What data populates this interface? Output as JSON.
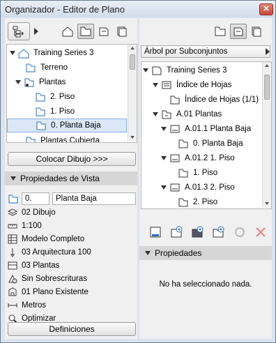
{
  "window": {
    "title": "Organizador - Editor de Plano",
    "close_glyph": "✕"
  },
  "left": {
    "tree": [
      {
        "label": "Training Series 3",
        "icon": "project-icon"
      },
      {
        "label": "Terreno",
        "icon": "story-icon"
      },
      {
        "label": "Plantas",
        "icon": "folder-icon"
      },
      {
        "label": "2. Piso",
        "icon": "story-icon"
      },
      {
        "label": "1. Piso",
        "icon": "story-icon"
      },
      {
        "label": "0. Planta Baja",
        "icon": "story-icon"
      },
      {
        "label": "Plantas Cubierta",
        "icon": "story-icon"
      }
    ],
    "place_button": "Colocar Dibujo >>>",
    "view_props_title": "Propiedades de Vista",
    "id_value": "0.",
    "name_value": "Planta Baja",
    "props": [
      {
        "label": "02 Dibujo",
        "icon": "layers-icon"
      },
      {
        "label": "1:100",
        "icon": "scale-icon"
      },
      {
        "label": "Modelo Completo",
        "icon": "structure-icon"
      },
      {
        "label": "03 Arquitectura 100",
        "icon": "pen-icon"
      },
      {
        "label": "03 Plantas",
        "icon": "model-view-icon"
      },
      {
        "label": "Sin Sobrescrituras",
        "icon": "override-icon"
      },
      {
        "label": "01 Plano Existente",
        "icon": "renovation-icon"
      },
      {
        "label": "Metros",
        "icon": "dimension-icon"
      },
      {
        "label": "Optimizar",
        "icon": "zoom-icon"
      }
    ],
    "definitions_button": "Definiciones"
  },
  "right": {
    "dropdown": "Árbol por Subconjuntos",
    "tree": [
      {
        "label": "Training Series 3",
        "icon": "layout-book-icon"
      },
      {
        "label": "Índice de Hojas",
        "icon": "index-icon"
      },
      {
        "label": "Índice de Hojas (1/1)",
        "icon": "sheet-icon"
      },
      {
        "label": "A.01 Plantas",
        "icon": "subset-icon"
      },
      {
        "label": "A.01.1 Planta Baja",
        "icon": "layout-icon"
      },
      {
        "label": "0. Planta Baja",
        "icon": "drawing-icon"
      },
      {
        "label": "A.01.2 1. Piso",
        "icon": "layout-icon"
      },
      {
        "label": "1. Piso",
        "icon": "drawing-icon"
      },
      {
        "label": "A.01.3 2. Piso",
        "icon": "layout-icon"
      },
      {
        "label": "2. Piso",
        "icon": "drawing-icon"
      }
    ],
    "props_title": "Propiedades",
    "empty_message": "No ha seleccionado nada."
  }
}
